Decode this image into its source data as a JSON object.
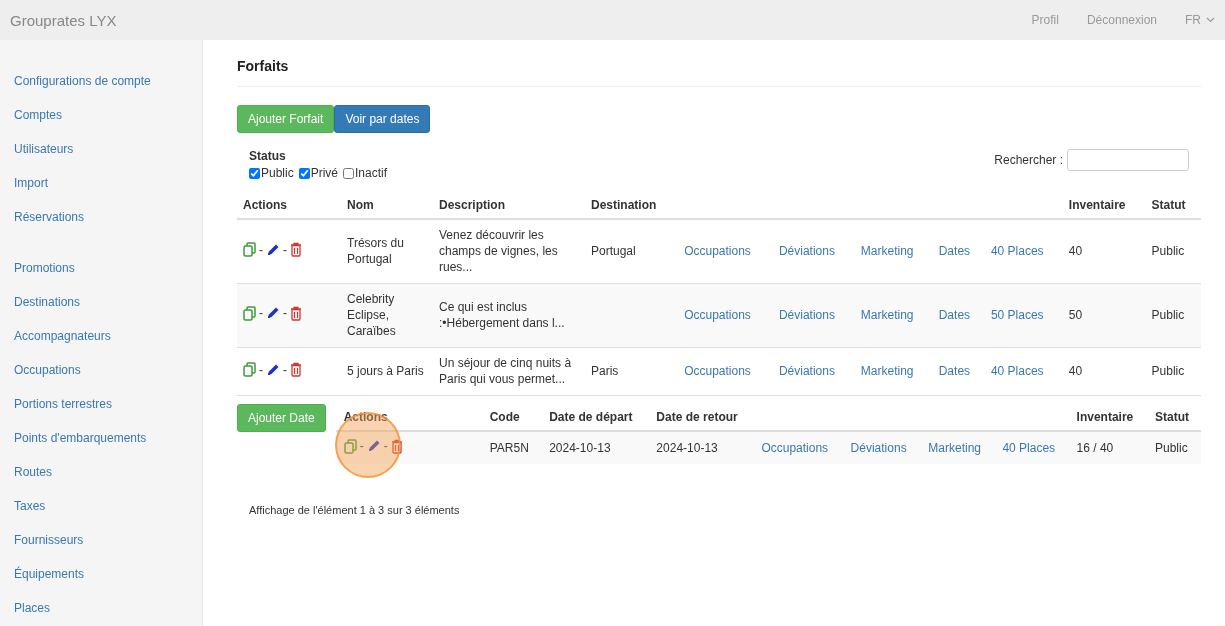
{
  "navbar": {
    "brand": "Grouprates LYX",
    "links": [
      "Profil",
      "Déconnexion"
    ],
    "language": "FR"
  },
  "sidebar": {
    "groups": [
      [
        "Configurations de compte",
        "Comptes",
        "Utilisateurs",
        "Import",
        "Réservations"
      ],
      [
        "Promotions",
        "Destinations",
        "Accompagnateurs",
        "Occupations",
        "Portions terrestres",
        "Points d'embarquements",
        "Routes",
        "Taxes",
        "Fournisseurs",
        "Équipements",
        "Places"
      ]
    ]
  },
  "page": {
    "title": "Forfaits",
    "buttons": [
      {
        "label": "Ajouter Forfait",
        "kind": "success"
      },
      {
        "label": "Voir par dates",
        "kind": "primary"
      }
    ],
    "status_filter": {
      "label": "Status",
      "options": [
        {
          "label": "Public",
          "checked": true
        },
        {
          "label": "Privé",
          "checked": true
        },
        {
          "label": "Inactif",
          "checked": false
        }
      ]
    },
    "search": {
      "label": "Rechercher :"
    },
    "table": {
      "columns": [
        "Actions",
        "Nom",
        "Description",
        "Destination",
        "Inventaire",
        "Statut"
      ],
      "rows": [
        {
          "separators": [
            "-",
            "-"
          ],
          "nom": "Trésors du Portugal",
          "description": "Venez découvrir les champs de vignes, les rues...",
          "destination": "Portugal",
          "links": [
            "Occupations",
            "Déviations",
            "Marketing",
            "Dates",
            "40 Places"
          ],
          "inventaire": "40",
          "statut": "Public"
        },
        {
          "separators": [
            "-",
            "-"
          ],
          "nom": "Celebrity Eclipse, Caraïbes",
          "description": "Ce qui est inclus :•Hébergement dans l...",
          "destination": "",
          "links": [
            "Occupations",
            "Déviations",
            "Marketing",
            "Dates",
            "50 Places"
          ],
          "inventaire": "50",
          "statut": "Public"
        },
        {
          "separators": [
            "-",
            "-"
          ],
          "nom": "5 jours à Paris",
          "description": "Un séjour de cinq nuits à Paris qui vous permet...",
          "destination": "Paris",
          "links": [
            "Occupations",
            "Déviations",
            "Marketing",
            "Dates",
            "40 Places"
          ],
          "inventaire": "40",
          "statut": "Public"
        }
      ]
    },
    "dates": {
      "button": "Ajouter Date",
      "columns": [
        "Actions",
        "Code",
        "Date de départ",
        "Date de retour",
        "Inventaire",
        "Statut"
      ],
      "rows": [
        {
          "separators": [
            "-",
            "-"
          ],
          "code": "PAR5N",
          "depart": "2024-10-13",
          "retour": "2024-10-13",
          "links": [
            "Occupations",
            "Déviations",
            "Marketing",
            "40 Places"
          ],
          "inventaire": "16 / 40",
          "statut": "Public"
        }
      ]
    },
    "footer": "Affichage de l'élément 1 à 3 sur 3 éléments"
  }
}
